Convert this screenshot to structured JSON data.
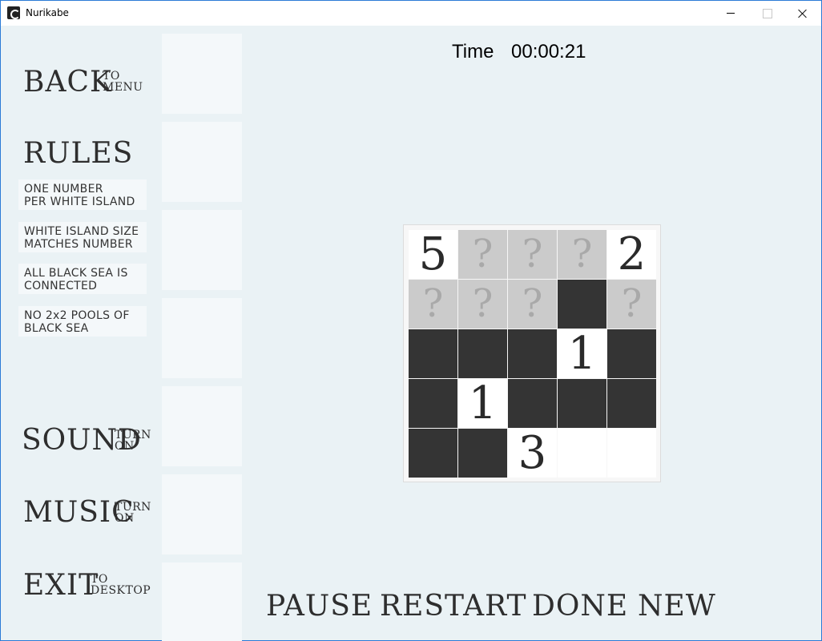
{
  "window": {
    "title": "Nurikabe"
  },
  "menu": {
    "back": {
      "big": "BACK",
      "small_top": "TO",
      "small_bottom": "MENU"
    },
    "rules": {
      "title": "RULES"
    },
    "sound": {
      "big": "SOUND",
      "small_top": "TURN",
      "small_bottom": "ON"
    },
    "music": {
      "big": "MUSIC",
      "small_top": "TURN",
      "small_bottom": "ON"
    },
    "exit": {
      "big": "EXIT",
      "small_top": "TO",
      "small_bottom": "DESKTOP"
    }
  },
  "rules": [
    {
      "line1": "ONE NUMBER",
      "line2": "PER WHITE ISLAND"
    },
    {
      "line1": "WHITE ISLAND SIZE",
      "line2": "MATCHES NUMBER"
    },
    {
      "line1": "ALL BLACK SEA IS",
      "line2": "CONNECTED"
    },
    {
      "line1": "NO 2x2 POOLS OF",
      "line2": "BLACK SEA"
    }
  ],
  "timer": {
    "label": "Time",
    "value": "00:00:21"
  },
  "board": {
    "rows": 5,
    "cols": 5,
    "unknown_symbol": "?",
    "cells": [
      [
        {
          "state": "white",
          "clue": "5"
        },
        {
          "state": "unknown"
        },
        {
          "state": "unknown"
        },
        {
          "state": "unknown"
        },
        {
          "state": "white",
          "clue": "2"
        }
      ],
      [
        {
          "state": "unknown"
        },
        {
          "state": "unknown"
        },
        {
          "state": "unknown"
        },
        {
          "state": "black"
        },
        {
          "state": "unknown"
        }
      ],
      [
        {
          "state": "black"
        },
        {
          "state": "black"
        },
        {
          "state": "black"
        },
        {
          "state": "white",
          "clue": "1"
        },
        {
          "state": "black"
        }
      ],
      [
        {
          "state": "black"
        },
        {
          "state": "white",
          "clue": "1"
        },
        {
          "state": "black"
        },
        {
          "state": "black"
        },
        {
          "state": "black"
        }
      ],
      [
        {
          "state": "black"
        },
        {
          "state": "black"
        },
        {
          "state": "white",
          "clue": "3"
        },
        {
          "state": "white"
        },
        {
          "state": "white"
        }
      ]
    ]
  },
  "actions": {
    "pause": "PAUSE",
    "restart": "RESTART",
    "done": "DONE",
    "new": "NEW"
  },
  "colors": {
    "background": "#eaf2f5",
    "black_cell": "#343434",
    "unknown_cell": "#cbcbcb",
    "white_cell": "#ffffff"
  }
}
